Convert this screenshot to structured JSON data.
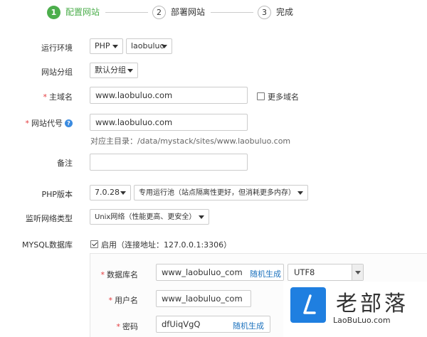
{
  "steps": [
    {
      "num": "1",
      "label": "配置网站",
      "active": true
    },
    {
      "num": "2",
      "label": "部署网站",
      "active": false
    },
    {
      "num": "3",
      "label": "完成",
      "active": false
    }
  ],
  "form": {
    "env": {
      "label": "运行环境",
      "lang": "PHP",
      "profile": "laobuluo"
    },
    "group": {
      "label": "网站分组",
      "value": "默认分组"
    },
    "domain": {
      "label": "主域名",
      "value": "www.laobuluo.com",
      "more_label": "更多域名"
    },
    "code": {
      "label": "网站代号",
      "value": "www.laobuluo.com",
      "help": "?",
      "root_hint": "对应主目录：/data/mystack/sites/www.laobuluo.com"
    },
    "remark": {
      "label": "备注",
      "value": ""
    },
    "php": {
      "label": "PHP版本",
      "version": "7.0.28",
      "pool": "专用运行池（站点隔离性更好，但消耗更多内存）"
    },
    "network": {
      "label": "监听网络类型",
      "value": "Unix网络（性能更高、更安全）"
    },
    "mysql": {
      "label": "MYSQL数据库",
      "enabled_label": "启用（连接地址：127.0.0.1:3306）",
      "dbname_label": "数据库名",
      "dbname": "www_laobuluo_com",
      "random1": "随机生成",
      "charset": "UTF8",
      "user_label": "用户名",
      "user": "www_laobuluo_com",
      "pass_label": "密码",
      "pass": "dfUiqVgQ",
      "random2": "随机生成"
    }
  },
  "required_mark": "*",
  "watermark": {
    "name": "老部落",
    "url": "LaoBuLuo.com",
    "accent": "#1f7fe0"
  }
}
